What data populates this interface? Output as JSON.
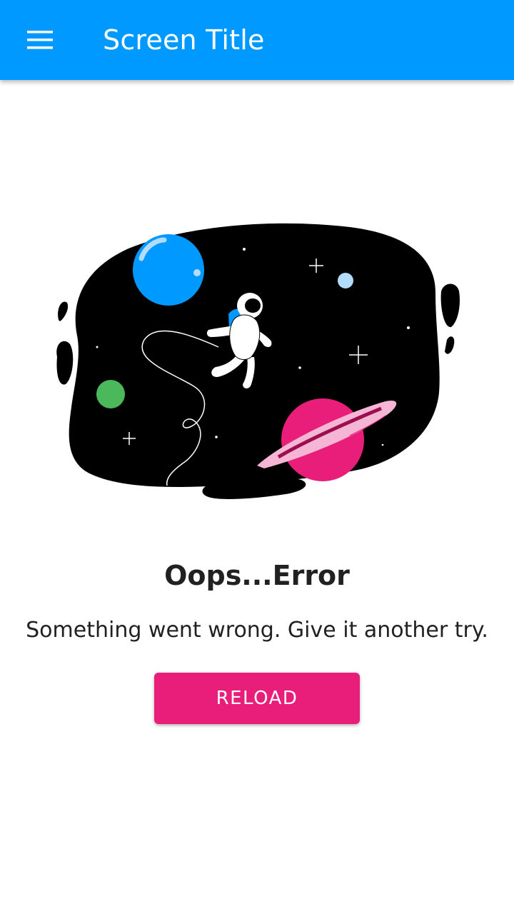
{
  "app_bar": {
    "title": "Screen Title",
    "menu_icon": "hamburger-menu-icon",
    "background_color": "#0099FF"
  },
  "illustration": {
    "subject": "astronaut-in-space-illustration"
  },
  "error": {
    "title": "Oops...Error",
    "message": "Something went wrong. Give it another try."
  },
  "actions": {
    "reload_label": "RELOAD",
    "reload_color": "#E91E7A"
  }
}
